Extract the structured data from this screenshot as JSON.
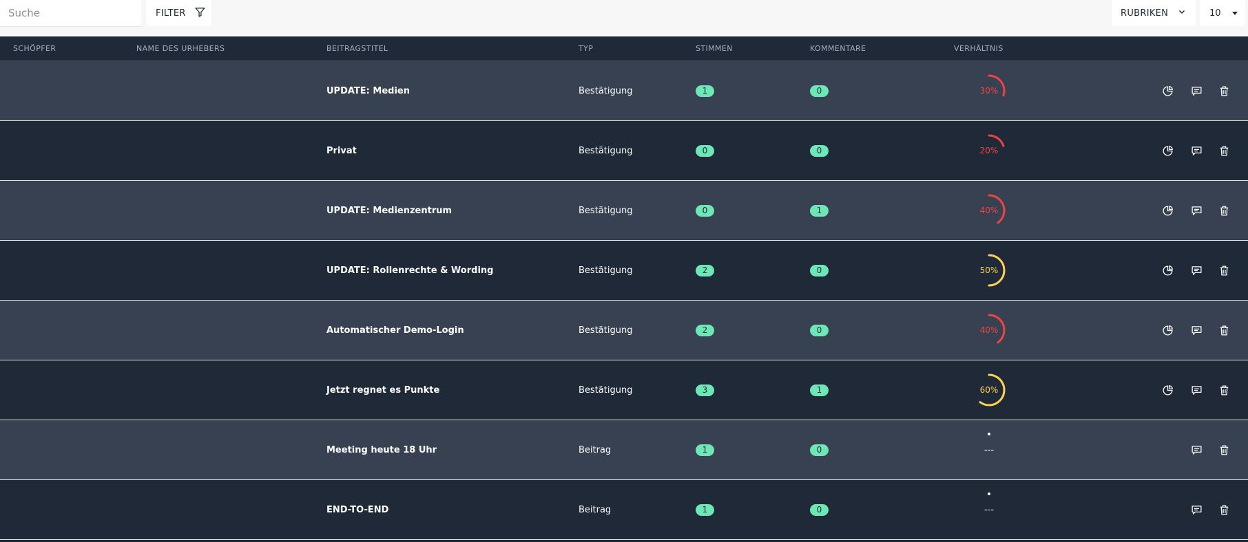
{
  "toolbar": {
    "search_placeholder": "Suche",
    "filter_label": "FILTER",
    "rubriken_label": "RUBRIKEN",
    "page_size": "10"
  },
  "table": {
    "headers": {
      "creator": "SCHÖPFER",
      "author_name": "NAME DES URHEBERS",
      "post_title": "BEITRAGSTITEL",
      "type": "TYP",
      "votes": "STIMMEN",
      "comments": "KOMMENTARE",
      "ratio": "VERHÄLTNIS"
    },
    "rows": [
      {
        "title": "UPDATE: Medien",
        "type": "Bestätigung",
        "votes": "1",
        "comments": "0",
        "ratio": "30%",
        "ratio_value": 0.3,
        "ratio_color": "#ef4444",
        "has_stats": true
      },
      {
        "title": "Privat",
        "type": "Bestätigung",
        "votes": "0",
        "comments": "0",
        "ratio": "20%",
        "ratio_value": 0.2,
        "ratio_color": "#ef4444",
        "has_stats": true
      },
      {
        "title": "UPDATE: Medienzentrum",
        "type": "Bestätigung",
        "votes": "0",
        "comments": "1",
        "ratio": "40%",
        "ratio_value": 0.4,
        "ratio_color": "#ef4444",
        "has_stats": true
      },
      {
        "title": "UPDATE: Rollenrechte & Wording",
        "type": "Bestätigung",
        "votes": "2",
        "comments": "0",
        "ratio": "50%",
        "ratio_value": 0.5,
        "ratio_color": "#fcd34d",
        "has_stats": true
      },
      {
        "title": "Automatischer Demo-Login",
        "type": "Bestätigung",
        "votes": "2",
        "comments": "0",
        "ratio": "40%",
        "ratio_value": 0.4,
        "ratio_color": "#ef4444",
        "has_stats": true
      },
      {
        "title": "Jetzt regnet es Punkte",
        "type": "Bestätigung",
        "votes": "3",
        "comments": "1",
        "ratio": "60%",
        "ratio_value": 0.6,
        "ratio_color": "#fcd34d",
        "has_stats": true
      },
      {
        "title": "Meeting heute 18 Uhr",
        "type": "Beitrag",
        "votes": "1",
        "comments": "0",
        "ratio": "---",
        "ratio_value": null,
        "ratio_color": "#ffffff",
        "has_stats": false
      },
      {
        "title": "END-TO-END",
        "type": "Beitrag",
        "votes": "1",
        "comments": "0",
        "ratio": "---",
        "ratio_value": null,
        "ratio_color": "#ffffff",
        "has_stats": false
      }
    ]
  },
  "colors": {
    "header_bg": "#1f2937",
    "row_light": "#374151",
    "row_dark": "#1f2937",
    "badge": "#6ee7b7",
    "ratio_low": "#ef4444",
    "ratio_mid": "#fcd34d"
  },
  "icons": {
    "filter": "filter-icon",
    "chevron": "chevron-down-icon",
    "stats": "pie-chart-icon",
    "comment": "comment-icon",
    "trash": "trash-icon"
  }
}
